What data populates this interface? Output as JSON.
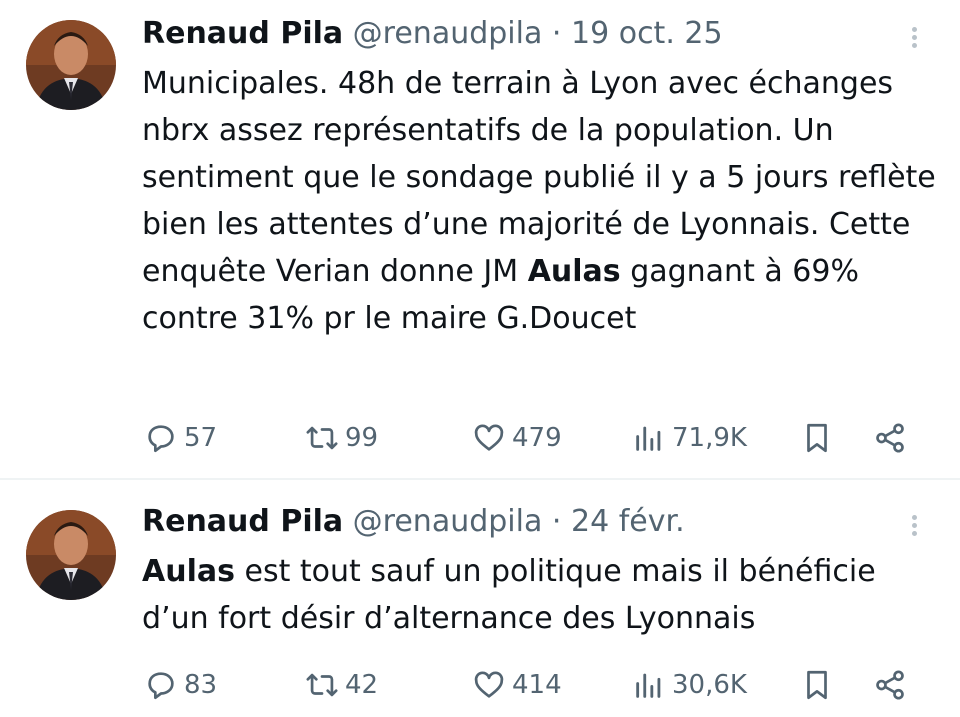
{
  "tweets": [
    {
      "author": "Renaud Pila",
      "handle": "@renaudpila",
      "separator": "·",
      "date": "19 oct. 25",
      "text_parts": {
        "before": "Municipales. 48h de terrain à Lyon avec échanges nbrx assez représentatifs de la population. Un sentiment que le sondage publié il y a 5 jours reflète bien les attentes d’une majorité de Lyonnais. Cette enquête Verian donne JM ",
        "bold": "Aulas",
        "after": " gagnant à 69% contre 31% pr le maire G.Doucet"
      },
      "stats": {
        "replies": "57",
        "retweets": "99",
        "likes": "479",
        "views": "71,9K"
      }
    },
    {
      "author": "Renaud Pila",
      "handle": "@renaudpila",
      "separator": "·",
      "date": "24 févr.",
      "text_parts": {
        "before": "",
        "bold": "Aulas",
        "after": " est tout sauf un politique mais il bénéficie d’un fort désir d’alternance des Lyonnais"
      },
      "stats": {
        "replies": "83",
        "retweets": "42",
        "likes": "414",
        "views": "30,6K"
      }
    }
  ],
  "icons": {
    "reply": "reply-icon",
    "retweet": "retweet-icon",
    "like": "heart-icon",
    "views": "views-icon",
    "bookmark": "bookmark-icon",
    "share": "share-icon",
    "more": "more-options-icon"
  },
  "colors": {
    "text": "#0f1419",
    "secondary": "#536471",
    "divider": "#eff3f4"
  }
}
